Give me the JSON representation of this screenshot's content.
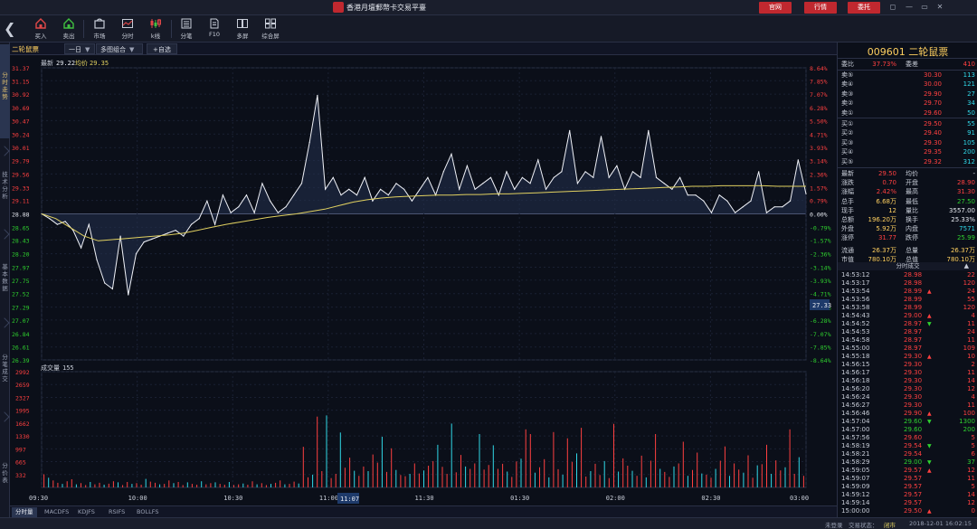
{
  "app": {
    "title": "香港月壇郵幣卡交易平臺",
    "buttons": [
      "官网",
      "行情",
      "委托"
    ],
    "window_controls": [
      "◻",
      "—",
      "▭",
      "✕"
    ]
  },
  "toolbar": {
    "items": [
      {
        "label": "买入",
        "icon": "buy-icon"
      },
      {
        "label": "卖出",
        "icon": "sell-icon"
      },
      {
        "label": "市场",
        "icon": "market-icon"
      },
      {
        "label": "分时",
        "icon": "timeshare-icon"
      },
      {
        "label": "k线",
        "icon": "kline-icon"
      },
      {
        "label": "分笔",
        "icon": "tick-icon"
      },
      {
        "label": "F10",
        "icon": "f10-icon"
      },
      {
        "label": "多屏",
        "icon": "multiscreen-icon"
      },
      {
        "label": "综合屏",
        "icon": "overview-icon"
      }
    ]
  },
  "left_rail": {
    "tabs": [
      "分时走势",
      "技术分析",
      "基本数据",
      "分笔成交",
      "分价表"
    ]
  },
  "chart_header": {
    "stock_tab": "二轮鼠票",
    "period": "一日",
    "combo": "多图组合",
    "watch": "+自选"
  },
  "price_chart": {
    "legend_latest_label": "最新",
    "legend_latest": "29.22",
    "legend_avg_label": "均价",
    "legend_avg": "29.35",
    "current_price_tag": "27.33",
    "prev_close_tag": "28.88"
  },
  "volume_chart": {
    "label": "成交量",
    "value": "155"
  },
  "cursor_time": "11:07",
  "chart_data": [
    {
      "type": "line",
      "title": "",
      "xlabel": "",
      "ylabel": "",
      "x_ticks": [
        "09:30",
        "10:00",
        "10:30",
        "11:00",
        "11:30",
        "01:30",
        "02:00",
        "02:30",
        "03:00"
      ],
      "ylim": [
        26.39,
        31.37
      ],
      "y_ticks": [
        31.37,
        31.15,
        30.92,
        30.69,
        30.47,
        30.24,
        30.01,
        29.79,
        29.56,
        29.33,
        29.11,
        28.88,
        28.65,
        28.43,
        28.2,
        27.97,
        27.75,
        27.52,
        27.29,
        27.07,
        26.84,
        26.61,
        26.39
      ],
      "y_ticks_right": [
        "8.64%",
        "7.85%",
        "7.07%",
        "6.28%",
        "5.50%",
        "4.71%",
        "3.93%",
        "3.14%",
        "2.36%",
        "1.57%",
        "0.79%",
        "0.00%",
        "-0.79%",
        "-1.57%",
        "-2.36%",
        "-3.14%",
        "-3.93%",
        "-4.71%",
        "-5.50%",
        "-6.28%",
        "-7.07%",
        "-7.85%",
        "-8.64%"
      ],
      "prev_close": 28.88,
      "series": [
        {
          "name": "最新",
          "values": [
            28.88,
            28.8,
            28.7,
            28.75,
            28.6,
            28.3,
            28.7,
            28.1,
            27.7,
            27.6,
            28.5,
            27.5,
            28.2,
            28.4,
            28.45,
            28.5,
            28.55,
            28.6,
            28.5,
            28.7,
            28.8,
            29.1,
            28.7,
            29.2,
            28.9,
            29.0,
            29.2,
            28.9,
            29.4,
            29.1,
            28.9,
            29.0,
            29.2,
            29.4,
            30.1,
            30.9,
            29.3,
            29.5,
            29.2,
            29.3,
            29.2,
            29.5,
            29.1,
            29.3,
            29.2,
            29.4,
            29.3,
            29.1,
            29.3,
            29.5,
            29.2,
            29.6,
            29.9,
            29.3,
            29.7,
            29.3,
            29.4,
            29.5,
            29.2,
            29.6,
            29.3,
            29.5,
            29.4,
            29.8,
            29.3,
            29.5,
            29.6,
            30.3,
            29.4,
            29.6,
            29.5,
            30.2,
            29.5,
            29.7,
            29.3,
            29.6,
            29.5,
            30.3,
            29.5,
            29.4,
            29.3,
            29.5,
            29.2,
            29.2,
            29.1,
            28.9,
            29.2,
            29.1,
            28.9,
            29.0,
            29.1,
            29.6,
            28.9,
            29.0,
            29.0,
            29.1,
            29.8,
            29.22
          ]
        },
        {
          "name": "均价",
          "values": [
            28.88,
            28.8,
            28.65,
            28.5,
            28.42,
            28.44,
            28.46,
            28.48,
            28.5,
            28.52,
            28.55,
            28.6,
            28.65,
            28.7,
            28.74,
            28.78,
            28.82,
            28.85,
            28.88,
            28.92,
            28.96,
            29.02,
            29.08,
            29.12,
            29.15,
            29.17,
            29.18,
            29.19,
            29.2,
            29.2,
            29.21,
            29.21,
            29.22,
            29.22,
            29.23,
            29.24,
            29.25,
            29.26,
            29.27,
            29.28,
            29.29,
            29.3,
            29.31,
            29.32,
            29.33,
            29.34,
            29.35,
            29.35,
            29.36,
            29.36,
            29.36,
            29.36,
            29.35,
            29.35,
            29.35
          ]
        }
      ]
    },
    {
      "type": "bar",
      "title": "",
      "ylim": [
        0,
        2992
      ],
      "y_ticks": [
        2992,
        2659,
        2327,
        1995,
        1662,
        1330,
        997,
        665,
        332
      ],
      "legend": [],
      "values": [
        340,
        250,
        180,
        120,
        90,
        160,
        210,
        80,
        110,
        60,
        140,
        80,
        120,
        70,
        95,
        160,
        130,
        60,
        140,
        90,
        110,
        70,
        220,
        150,
        120,
        80,
        90,
        180,
        110,
        140,
        60,
        130,
        90,
        70,
        160,
        80,
        110,
        130,
        90,
        70,
        140,
        60,
        80,
        100,
        70,
        160,
        80,
        110,
        60,
        90,
        120,
        180,
        80,
        90,
        150,
        100,
        1050,
        260,
        330,
        1830,
        420,
        1860,
        240,
        350,
        1420,
        510,
        770,
        430,
        300,
        540,
        420,
        850,
        640,
        1310,
        400,
        1010,
        450,
        320,
        290,
        350,
        620,
        360,
        440,
        560,
        680,
        1100,
        530,
        350,
        1650,
        390,
        840,
        540,
        480,
        620,
        1380,
        460,
        580,
        1090,
        480,
        610,
        410,
        270,
        670,
        740,
        1500,
        1380,
        380,
        520,
        730,
        260,
        1430,
        470,
        330,
        1270,
        660,
        880,
        1540,
        280,
        420,
        610,
        320,
        680,
        240,
        1640,
        410,
        750,
        560,
        430,
        300,
        820,
        260,
        690,
        1380,
        480,
        400,
        270,
        540,
        620,
        1180,
        300,
        450,
        900,
        360,
        330,
        250,
        480,
        690,
        1060,
        300,
        620,
        460,
        380,
        830,
        250,
        570,
        600,
        1100,
        350,
        700,
        440,
        520,
        1500,
        350,
        780,
        300
      ]
    }
  ],
  "quote_panel": {
    "title": "009601 二轮鼠票",
    "wei_bi_label": "委比",
    "wei_bi": "37.73%",
    "wei_cha_label": "委差",
    "wei_cha": "410",
    "asks": [
      {
        "label": "卖⑤",
        "price": "30.30",
        "vol": "113"
      },
      {
        "label": "卖④",
        "price": "30.00",
        "vol": "121"
      },
      {
        "label": "卖③",
        "price": "29.90",
        "vol": "27"
      },
      {
        "label": "卖②",
        "price": "29.70",
        "vol": "34"
      },
      {
        "label": "卖①",
        "price": "29.60",
        "vol": "50"
      }
    ],
    "bids": [
      {
        "label": "买①",
        "price": "29.50",
        "vol": "55"
      },
      {
        "label": "买②",
        "price": "29.40",
        "vol": "91"
      },
      {
        "label": "买③",
        "price": "29.30",
        "vol": "105"
      },
      {
        "label": "买④",
        "price": "29.35",
        "vol": "200"
      },
      {
        "label": "买⑤",
        "price": "29.32",
        "vol": "312"
      }
    ],
    "stats": [
      {
        "l1": "最新",
        "v1": "29.50",
        "c1": "red",
        "l2": "均价",
        "v2": "-",
        "c2": "white"
      },
      {
        "l1": "涨跌",
        "v1": "0.70",
        "c1": "red",
        "l2": "开盘",
        "v2": "28.90",
        "c2": "red"
      },
      {
        "l1": "涨幅",
        "v1": "2.42%",
        "c1": "red",
        "l2": "最高",
        "v2": "31.30",
        "c2": "red"
      },
      {
        "l1": "总手",
        "v1": "6.68万",
        "c1": "yellow",
        "l2": "最低",
        "v2": "27.50",
        "c2": "green"
      },
      {
        "l1": "现手",
        "v1": "12",
        "c1": "yellow",
        "l2": "量比",
        "v2": "3557.00",
        "c2": "white"
      },
      {
        "l1": "总额",
        "v1": "196.20万",
        "c1": "yellow",
        "l2": "换手",
        "v2": "25.33%",
        "c2": "white"
      },
      {
        "l1": "外盘",
        "v1": "5.92万",
        "c1": "yellow",
        "l2": "内盘",
        "v2": "7571",
        "c2": "cyan"
      },
      {
        "l1": "涨停",
        "v1": "31.77",
        "c1": "red",
        "l2": "跌停",
        "v2": "25.99",
        "c2": "green"
      },
      {
        "l1": "流通",
        "v1": "26.37万",
        "c1": "yellow",
        "l2": "总量",
        "v2": "26.37万",
        "c2": "yellow"
      },
      {
        "l1": "市值",
        "v1": "780.10万",
        "c1": "yellow",
        "l2": "总值",
        "v2": "780.10万",
        "c2": "yellow"
      }
    ],
    "ticks_header": "分时成交",
    "ticks": [
      {
        "t": "14:53:12",
        "p": "28.98",
        "a": "",
        "v": "22",
        "c": "red"
      },
      {
        "t": "14:53:17",
        "p": "28.98",
        "a": "",
        "v": "120",
        "c": "red"
      },
      {
        "t": "14:53:54",
        "p": "28.99",
        "a": "▲",
        "v": "24",
        "c": "red"
      },
      {
        "t": "14:53:56",
        "p": "28.99",
        "a": "",
        "v": "55",
        "c": "red"
      },
      {
        "t": "14:53:58",
        "p": "28.99",
        "a": "",
        "v": "120",
        "c": "red"
      },
      {
        "t": "14:54:43",
        "p": "29.00",
        "a": "▲",
        "v": "4",
        "c": "red"
      },
      {
        "t": "14:54:52",
        "p": "28.97",
        "a": "▼",
        "v": "11",
        "c": "red"
      },
      {
        "t": "14:54:53",
        "p": "28.97",
        "a": "",
        "v": "24",
        "c": "red"
      },
      {
        "t": "14:54:58",
        "p": "28.97",
        "a": "",
        "v": "11",
        "c": "red"
      },
      {
        "t": "14:55:00",
        "p": "28.97",
        "a": "",
        "v": "109",
        "c": "red"
      },
      {
        "t": "14:55:18",
        "p": "29.30",
        "a": "▲",
        "v": "10",
        "c": "red"
      },
      {
        "t": "14:56:15",
        "p": "29.30",
        "a": "",
        "v": "2",
        "c": "red"
      },
      {
        "t": "14:56:17",
        "p": "29.30",
        "a": "",
        "v": "11",
        "c": "red"
      },
      {
        "t": "14:56:18",
        "p": "29.30",
        "a": "",
        "v": "14",
        "c": "red"
      },
      {
        "t": "14:56:20",
        "p": "29.30",
        "a": "",
        "v": "12",
        "c": "red"
      },
      {
        "t": "14:56:24",
        "p": "29.30",
        "a": "",
        "v": "4",
        "c": "red"
      },
      {
        "t": "14:56:27",
        "p": "29.30",
        "a": "",
        "v": "11",
        "c": "red"
      },
      {
        "t": "14:56:46",
        "p": "29.90",
        "a": "▲",
        "v": "100",
        "c": "red"
      },
      {
        "t": "14:57:04",
        "p": "29.60",
        "a": "▼",
        "v": "1300",
        "c": "green"
      },
      {
        "t": "14:57:00",
        "p": "29.60",
        "a": "",
        "v": "200",
        "c": "green"
      },
      {
        "t": "14:57:56",
        "p": "29.60",
        "a": "",
        "v": "5",
        "c": "red"
      },
      {
        "t": "14:58:19",
        "p": "29.54",
        "a": "▼",
        "v": "5",
        "c": "red"
      },
      {
        "t": "14:58:21",
        "p": "29.54",
        "a": "",
        "v": "6",
        "c": "red"
      },
      {
        "t": "14:58:29",
        "p": "29.00",
        "a": "▼",
        "v": "37",
        "c": "green"
      },
      {
        "t": "14:59:05",
        "p": "29.57",
        "a": "▲",
        "v": "12",
        "c": "red"
      },
      {
        "t": "14:59:07",
        "p": "29.57",
        "a": "",
        "v": "11",
        "c": "red"
      },
      {
        "t": "14:59:09",
        "p": "29.57",
        "a": "",
        "v": "5",
        "c": "red"
      },
      {
        "t": "14:59:12",
        "p": "29.57",
        "a": "",
        "v": "14",
        "c": "red"
      },
      {
        "t": "14:59:14",
        "p": "29.57",
        "a": "",
        "v": "12",
        "c": "red"
      },
      {
        "t": "15:00:00",
        "p": "29.50",
        "a": "▲",
        "v": "0",
        "c": "red"
      }
    ]
  },
  "bottom_tabs": [
    "分时量",
    "MACDFS",
    "KDJFS",
    "RSIFS",
    "BOLLFS"
  ],
  "status": {
    "login": "未登录",
    "trade_state_label": "交易状态：",
    "trade_state": "闭市",
    "datetime": "2018-12-01 16:02:15"
  },
  "colors": {
    "price_line": "#ffffff",
    "avg_line": "#e0d060",
    "up": "#ff4040",
    "down": "#2fd02f",
    "accent": "#c0282f"
  }
}
